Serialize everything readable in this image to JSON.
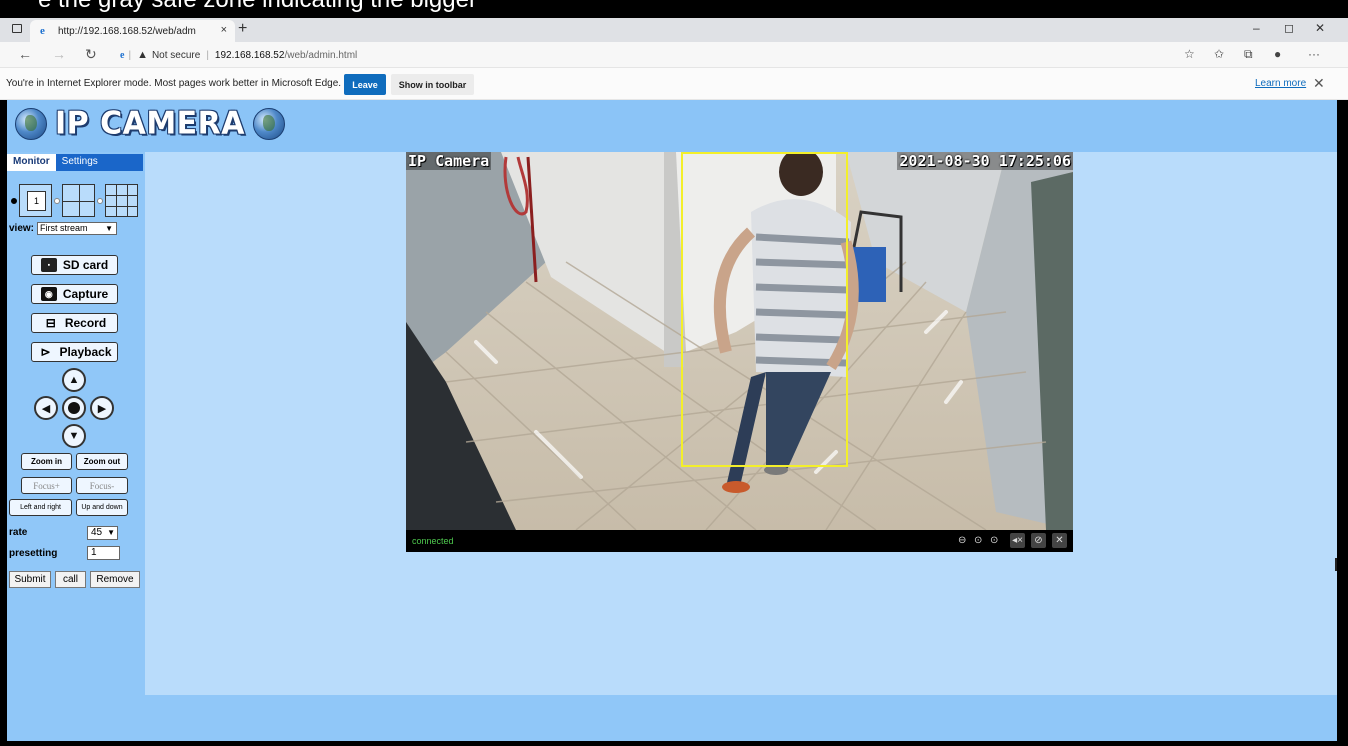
{
  "top_strip": {
    "text": "e the gray safe zone indicating the bigger"
  },
  "browser": {
    "tab_title": "http://192.168.168.52/web/adm",
    "tab_close": "×",
    "new_tab": "+",
    "window_controls": {
      "minimize": "–",
      "maximize": "◻",
      "close": "✕"
    },
    "address": {
      "security_label": "Not secure",
      "host": "192.168.168.52",
      "path": "/web/admin.html"
    }
  },
  "ie_bar": {
    "message": "You're in Internet Explorer mode. Most pages work better in Microsoft Edge.",
    "leave_label": "Leave",
    "show_toolbar_label": "Show in toolbar",
    "learn_more_label": "Learn more"
  },
  "logo": {
    "text": "IP CAMERA"
  },
  "sidebar": {
    "tabs": [
      {
        "label": "Monitor",
        "active": true
      },
      {
        "label": "Settings",
        "active": false
      }
    ],
    "layout_single_label": "1",
    "view_label": "view:",
    "view_selected": "First stream",
    "buttons": {
      "sd_card": "SD card",
      "capture": "Capture",
      "record": "Record",
      "playback": "Playback"
    },
    "ptz": {
      "zoom_in": "Zoom in",
      "zoom_out": "Zoom out",
      "focus_plus": "Focus+",
      "focus_minus": "Focus-",
      "left_right": "Left and right",
      "up_down": "Up and down"
    },
    "rate_label": "rate",
    "rate_value": "45",
    "presetting_label": "presetting",
    "presetting_value": "1",
    "submit_label": "Submit",
    "call_label": "call",
    "remove_label": "Remove"
  },
  "video": {
    "osd_name": "IP Camera",
    "osd_time": "2021-08-30 17:25:06",
    "status": "connected",
    "detection_box_color": "#f3ef2a"
  },
  "colors": {
    "page_bg": "#90c7f8",
    "panel_bg": "#b9dcfb",
    "tab_blue": "#1a66c9",
    "leave_blue": "#0f6cbd"
  }
}
